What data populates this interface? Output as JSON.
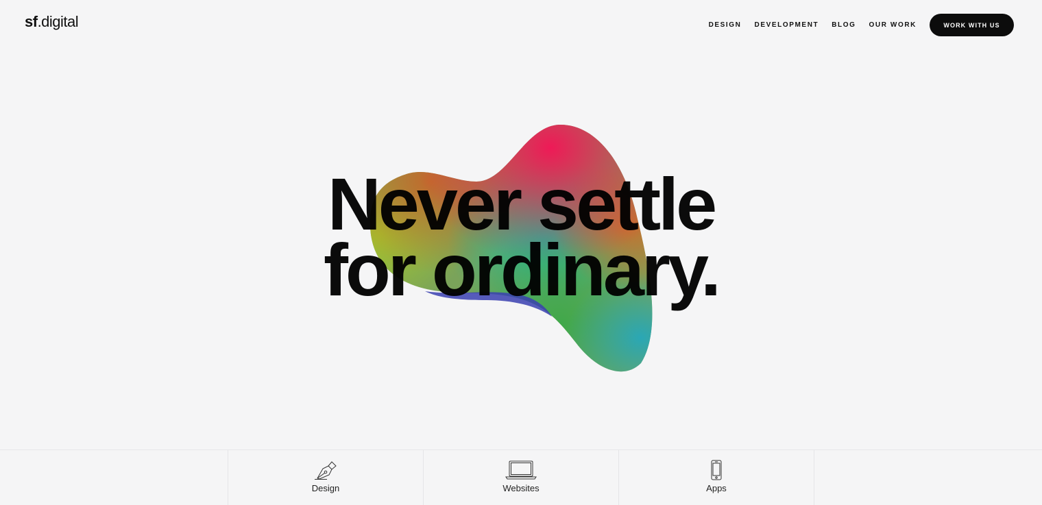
{
  "header": {
    "logo_bold": "sf",
    "logo_light": ".digital",
    "nav": [
      {
        "label": "DESIGN"
      },
      {
        "label": "DEVELOPMENT"
      },
      {
        "label": "BLOG"
      },
      {
        "label": "OUR WORK"
      }
    ],
    "cta_label": "WORK WITH US"
  },
  "hero": {
    "line1": "Never settle",
    "line2": "for ordinary.",
    "blob_colors": [
      "#ee1a57",
      "#c26a2c",
      "#a4c82b",
      "#1fb89a",
      "#6a4bd6",
      "#3fa84a",
      "#2aa7b5"
    ]
  },
  "services": [
    {
      "label": "Design",
      "icon": "pen-nib-icon"
    },
    {
      "label": "Websites",
      "icon": "laptop-icon"
    },
    {
      "label": "Apps",
      "icon": "smartphone-icon"
    }
  ]
}
